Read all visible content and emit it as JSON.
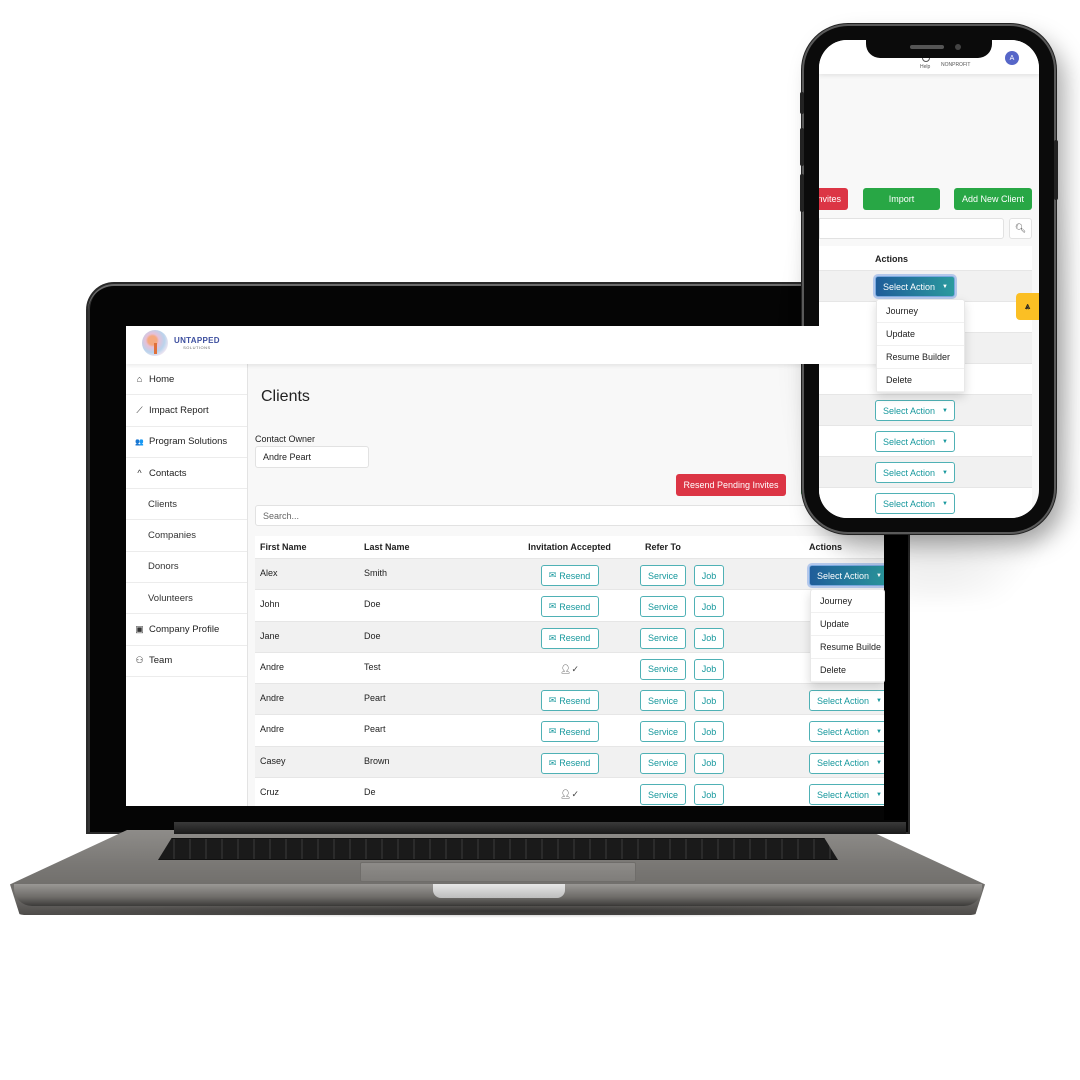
{
  "laptop": {
    "brand": {
      "name": "UNTAPPED",
      "tagline": "SOLUTIONS"
    },
    "sidebar": {
      "items": [
        {
          "label": "Home",
          "icon": "home-icon",
          "glyph": "⌂"
        },
        {
          "label": "Impact Report",
          "icon": "chart-line-icon",
          "glyph": "⟋"
        },
        {
          "label": "Program Solutions",
          "icon": "users-icon",
          "glyph": "👥"
        },
        {
          "label": "Contacts",
          "icon": "chevron-up-icon",
          "glyph": "^"
        },
        {
          "label": "Clients",
          "icon": "",
          "glyph": ""
        },
        {
          "label": "Companies",
          "icon": "",
          "glyph": ""
        },
        {
          "label": "Donors",
          "icon": "",
          "glyph": ""
        },
        {
          "label": "Volunteers",
          "icon": "",
          "glyph": ""
        },
        {
          "label": "Company Profile",
          "icon": "id-badge-icon",
          "glyph": "▣"
        },
        {
          "label": "Team",
          "icon": "team-icon",
          "glyph": "⚇"
        }
      ]
    },
    "page": {
      "title": "Clients",
      "contact_owner_label": "Contact Owner",
      "contact_owner_value": "Andre Peart",
      "resend_pending_label": "Resend Pending Invites",
      "search_placeholder": "Search..."
    },
    "table": {
      "columns": [
        "First Name",
        "Last Name",
        "Invitation Accepted",
        "Refer To",
        "Actions"
      ],
      "rows": [
        {
          "first": "Alex",
          "last": "Smith",
          "invitation": "resend",
          "action_state": "open"
        },
        {
          "first": "John",
          "last": "Doe",
          "invitation": "resend",
          "action_state": "hidden"
        },
        {
          "first": "Jane",
          "last": "Doe",
          "invitation": "resend",
          "action_state": "hidden"
        },
        {
          "first": "Andre",
          "last": "Test",
          "invitation": "accepted",
          "action_state": "hidden"
        },
        {
          "first": "Andre",
          "last": "Peart",
          "invitation": "resend",
          "action_state": "closed"
        },
        {
          "first": "Andre",
          "last": "Peart",
          "invitation": "resend",
          "action_state": "closed"
        },
        {
          "first": "Casey",
          "last": "Brown",
          "invitation": "resend",
          "action_state": "closed"
        },
        {
          "first": "Cruz",
          "last": "De",
          "invitation": "accepted",
          "action_state": "closed"
        }
      ],
      "resend_label": "Resend",
      "service_label": "Service",
      "job_label": "Job",
      "select_action_label": "Select Action",
      "accepted_icon": "user-check-icon"
    },
    "dropdown": {
      "items": [
        "Journey",
        "Update",
        "Resume Builde",
        "Delete"
      ]
    }
  },
  "phone": {
    "header": {
      "help_label": "Help",
      "org_label": "NONPROFIT",
      "avatar_initial": "A"
    },
    "buttons": {
      "invites_partial": "nvites",
      "import": "Import",
      "add_new_client": "Add New Client"
    },
    "table": {
      "actions_header": "Actions",
      "select_action_label": "Select Action",
      "row_count": 8
    },
    "dropdown": {
      "items": [
        "Journey",
        "Update",
        "Resume Builder",
        "Delete"
      ]
    },
    "fab_glyph": "⩓"
  },
  "colors": {
    "teal": "#17989d",
    "danger": "#dc3545",
    "success": "#28a745",
    "brand_blue": "#3d4f9f",
    "avatar": "#5666c8",
    "fab": "#fbbf24"
  }
}
